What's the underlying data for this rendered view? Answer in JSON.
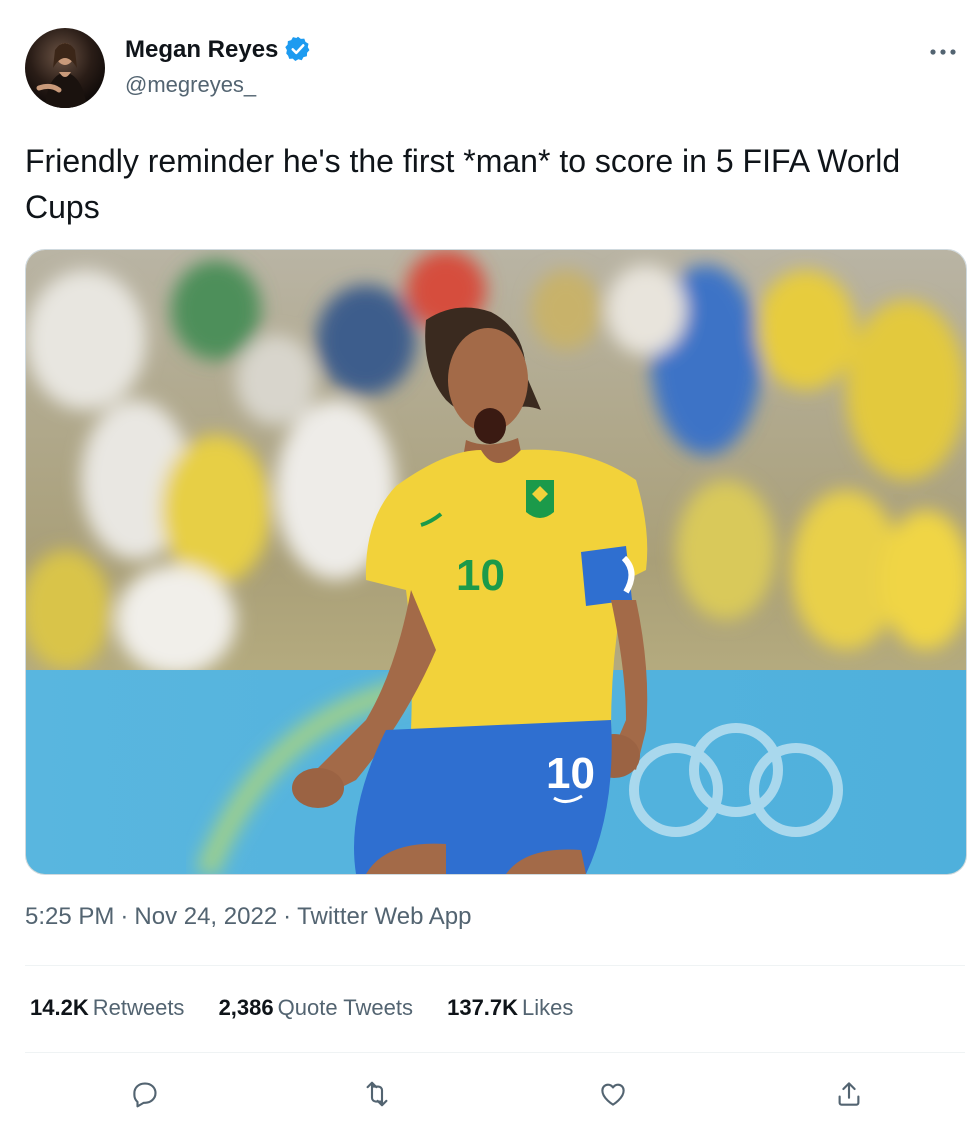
{
  "author": {
    "display_name": "Megan Reyes",
    "handle": "@megreyes_",
    "verified": true
  },
  "tweet": {
    "text": "Friendly reminder he's the first *man* to score in 5 FIFA World Cups",
    "time": "5:25 PM",
    "date": "Nov 24, 2022",
    "source": "Twitter Web App",
    "separator": "·"
  },
  "media": {
    "jersey_number": "10",
    "shorts_number": "10"
  },
  "stats": {
    "retweets": {
      "value": "14.2K",
      "label": "Retweets"
    },
    "quote_tweets": {
      "value": "2,386",
      "label": "Quote Tweets"
    },
    "likes": {
      "value": "137.7K",
      "label": "Likes"
    }
  },
  "icons": {
    "verified": "verified-badge-icon",
    "more": "more-dots-icon",
    "reply": "reply-icon",
    "retweet": "retweet-icon",
    "like": "heart-icon",
    "share": "share-icon"
  },
  "colors": {
    "verified_blue": "#1d9bf0",
    "text": "#0f1419",
    "secondary": "#536471",
    "jersey_yellow": "#f2d23a",
    "shorts_blue": "#2f6fd0",
    "number_green": "#1b9a4a"
  }
}
